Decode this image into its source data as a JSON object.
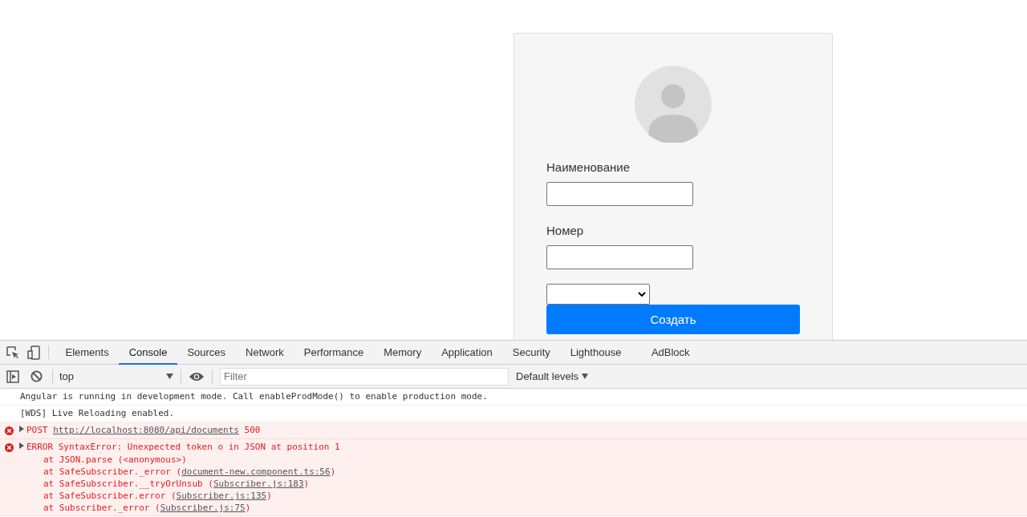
{
  "form": {
    "fields": [
      {
        "label": "Наименование"
      },
      {
        "label": "Номер"
      }
    ],
    "submit": "Создать"
  },
  "devtools": {
    "tabs": [
      {
        "label": "Elements",
        "selected": false
      },
      {
        "label": "Console",
        "selected": true
      },
      {
        "label": "Sources",
        "selected": false
      },
      {
        "label": "Network",
        "selected": false
      },
      {
        "label": "Performance",
        "selected": false
      },
      {
        "label": "Memory",
        "selected": false
      },
      {
        "label": "Application",
        "selected": false
      },
      {
        "label": "Security",
        "selected": false
      },
      {
        "label": "Lighthouse",
        "selected": false
      },
      {
        "label": "AdBlock",
        "selected": false
      }
    ],
    "context": "top",
    "filter": {
      "placeholder": "Filter"
    },
    "levels": "Default levels",
    "messages": [
      {
        "kind": "info",
        "text": "Angular is running in development mode. Call enableProdMode() to enable production mode."
      },
      {
        "kind": "info",
        "text": "[WDS] Live Reloading enabled."
      },
      {
        "kind": "error",
        "parts": [
          {
            "text": "POST "
          },
          {
            "text": "http://localhost:8080/api/documents",
            "link": true
          },
          {
            "text": " 500"
          }
        ]
      },
      {
        "kind": "error",
        "parts": [
          {
            "text": "ERROR SyntaxError: Unexpected token o in JSON at position 1"
          }
        ],
        "stack": [
          [
            {
              "text": "at JSON.parse (<anonymous>)"
            }
          ],
          [
            {
              "text": "at SafeSubscriber._error ("
            },
            {
              "text": "document-new.component.ts:56",
              "link": true
            },
            {
              "text": ")"
            }
          ],
          [
            {
              "text": "at SafeSubscriber.__tryOrUnsub ("
            },
            {
              "text": "Subscriber.js:183",
              "link": true
            },
            {
              "text": ")"
            }
          ],
          [
            {
              "text": "at SafeSubscriber.error ("
            },
            {
              "text": "Subscriber.js:135",
              "link": true
            },
            {
              "text": ")"
            }
          ],
          [
            {
              "text": "at Subscriber._error ("
            },
            {
              "text": "Subscriber.js:75",
              "link": true
            },
            {
              "text": ")"
            }
          ]
        ]
      }
    ]
  }
}
